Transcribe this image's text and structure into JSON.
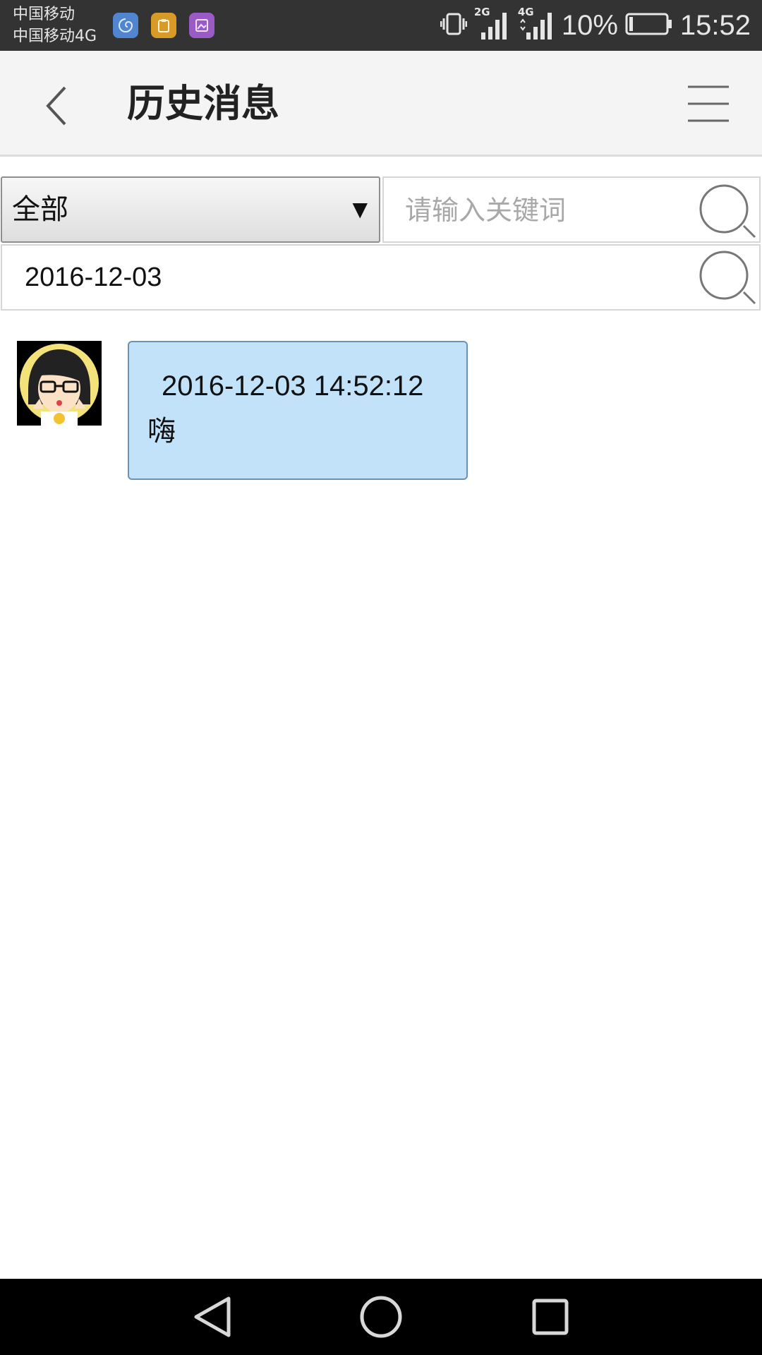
{
  "status_bar": {
    "carrier_1": "中国移动",
    "carrier_2": "中国移动4G",
    "notification_icons": [
      "swirl-app-icon",
      "clipboard-app-icon",
      "gallery-app-icon"
    ],
    "signal_1_label": "2G",
    "signal_2_label": "4G",
    "battery_percent": "10%",
    "battery_level": 0.1,
    "time": "15:52"
  },
  "header": {
    "title": "历史消息",
    "back_icon": "chevron-left-icon",
    "menu_icon": "hamburger-menu-icon"
  },
  "filter": {
    "category_selected": "全部",
    "keyword_placeholder": "请输入关键词",
    "keyword_value": "",
    "search_icon": "search-icon"
  },
  "date_filter": {
    "value": "2016-12-03"
  },
  "messages": [
    {
      "timestamp": "2016-12-03 14:52:12",
      "text": "嗨"
    }
  ],
  "colors": {
    "status_bar_bg": "#333333",
    "header_bg": "#f4f4f4",
    "bubble_bg": "#c2e2fa",
    "bubble_border": "#6a93b3",
    "nav_bar_bg": "#000000"
  },
  "nav_bar": {
    "icons": [
      "back-triangle-icon",
      "home-circle-icon",
      "recents-square-icon"
    ]
  }
}
